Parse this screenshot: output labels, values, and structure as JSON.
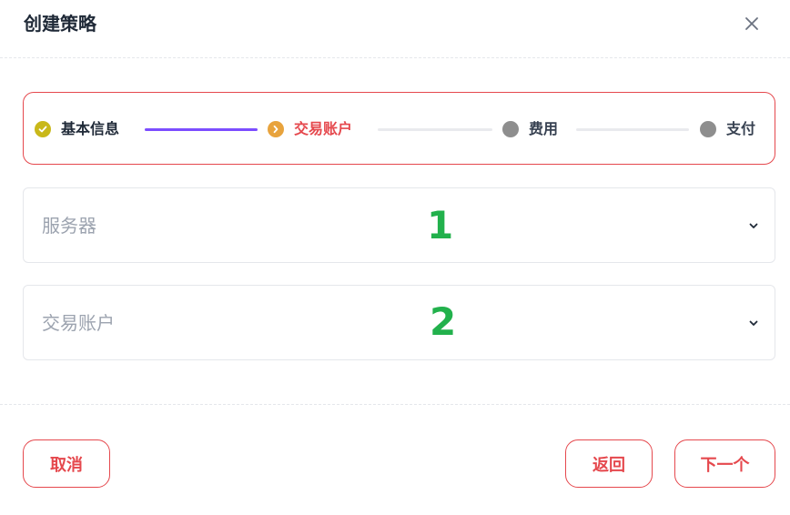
{
  "dialog": {
    "title": "创建策略"
  },
  "steps": [
    {
      "label": "基本信息",
      "status": "done"
    },
    {
      "label": "交易账户",
      "status": "active"
    },
    {
      "label": "费用",
      "status": "pending"
    },
    {
      "label": "支付",
      "status": "pending"
    }
  ],
  "form": {
    "server_placeholder": "服务器",
    "account_placeholder": "交易账户"
  },
  "annotations": {
    "marker_1": "1",
    "marker_2": "2"
  },
  "footer": {
    "cancel_label": "取消",
    "back_label": "返回",
    "next_label": "下一个"
  },
  "colors": {
    "accent_red": "#e5484d",
    "progress_purple": "#7c4dff",
    "done_yellow": "#c9b81a",
    "active_orange": "#e8a33d",
    "pending_gray": "#8e8e8e",
    "marker_green": "#22b14c"
  },
  "icons": {
    "close": "close-icon",
    "step_done": "check-circle-icon",
    "step_active": "chevron-right-circle-icon",
    "step_pending": "dot-icon",
    "select_arrow": "chevron-down-icon"
  }
}
